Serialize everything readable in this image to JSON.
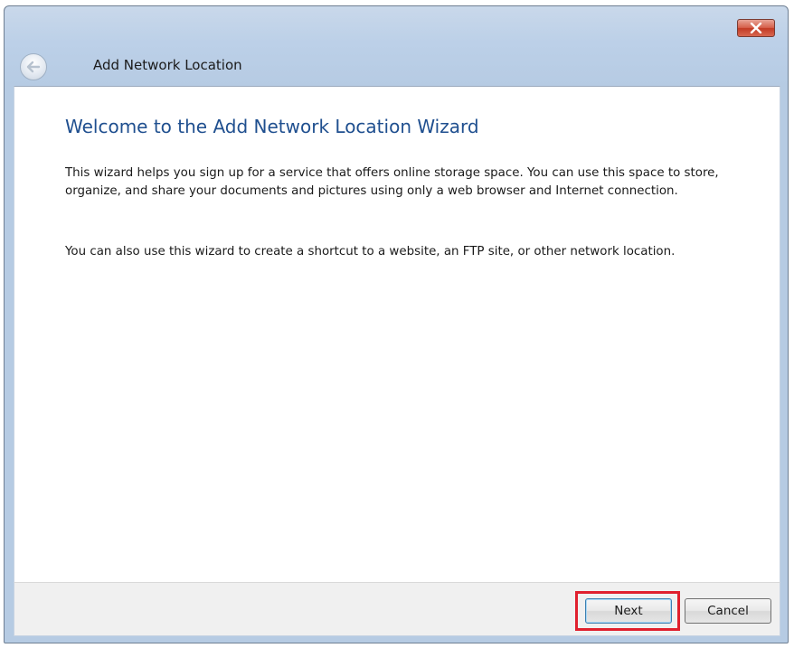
{
  "window": {
    "title": "Add Network Location"
  },
  "titlebar": {
    "close_icon": "close-icon",
    "back_icon": "back-arrow-icon"
  },
  "content": {
    "heading": "Welcome to the Add Network Location Wizard",
    "paragraph1": "This wizard helps you sign up for a service that offers online storage space.  You can use this space to store, organize, and share your documents and pictures using only a web browser and Internet connection.",
    "paragraph2": "You can also use this wizard to create a shortcut to a website, an FTP site, or other network location."
  },
  "footer": {
    "next_label": "Next",
    "cancel_label": "Cancel"
  },
  "colors": {
    "heading": "#1f4f8f",
    "highlight": "#e0202e",
    "close_button": "#c23a24"
  }
}
